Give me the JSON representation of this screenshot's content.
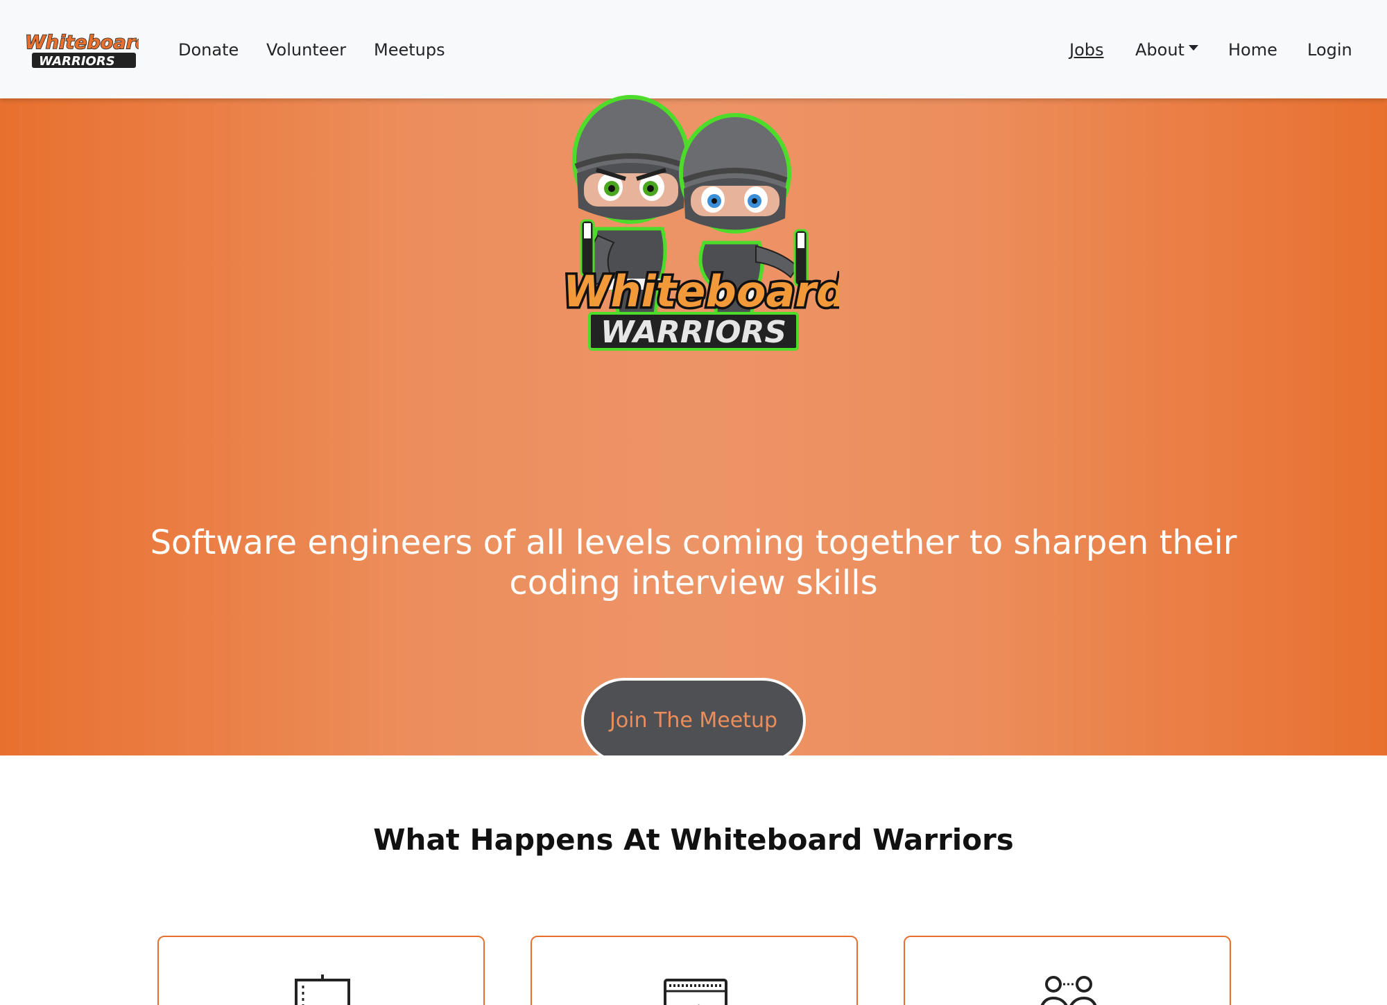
{
  "brand": {
    "line1": "Whiteboard",
    "line2": "WARRIORS",
    "orange": "#e8702f",
    "green": "#4ddc2a",
    "gray": "#6b6c70"
  },
  "nav": {
    "left": [
      "Donate",
      "Volunteer",
      "Meetups"
    ],
    "right": [
      "Jobs",
      "About",
      "Home",
      "Login"
    ]
  },
  "hero": {
    "logo_line1": "Whiteboard",
    "logo_line2": "WARRIORS",
    "tagline": "Software engineers of all levels coming together to sharpen their coding interview skills",
    "cta": "Join The Meetup"
  },
  "section": {
    "title": "What Happens At Whiteboard Warriors"
  },
  "cards": [
    {
      "icon": "whiteboard-icon"
    },
    {
      "icon": "code-window-icon"
    },
    {
      "icon": "pair-programming-icon"
    }
  ],
  "colors": {
    "accent": "#e8702f",
    "accent_light": "#ed9467",
    "button_bg": "#4f5054",
    "navbar_bg": "#f8f9fa"
  }
}
